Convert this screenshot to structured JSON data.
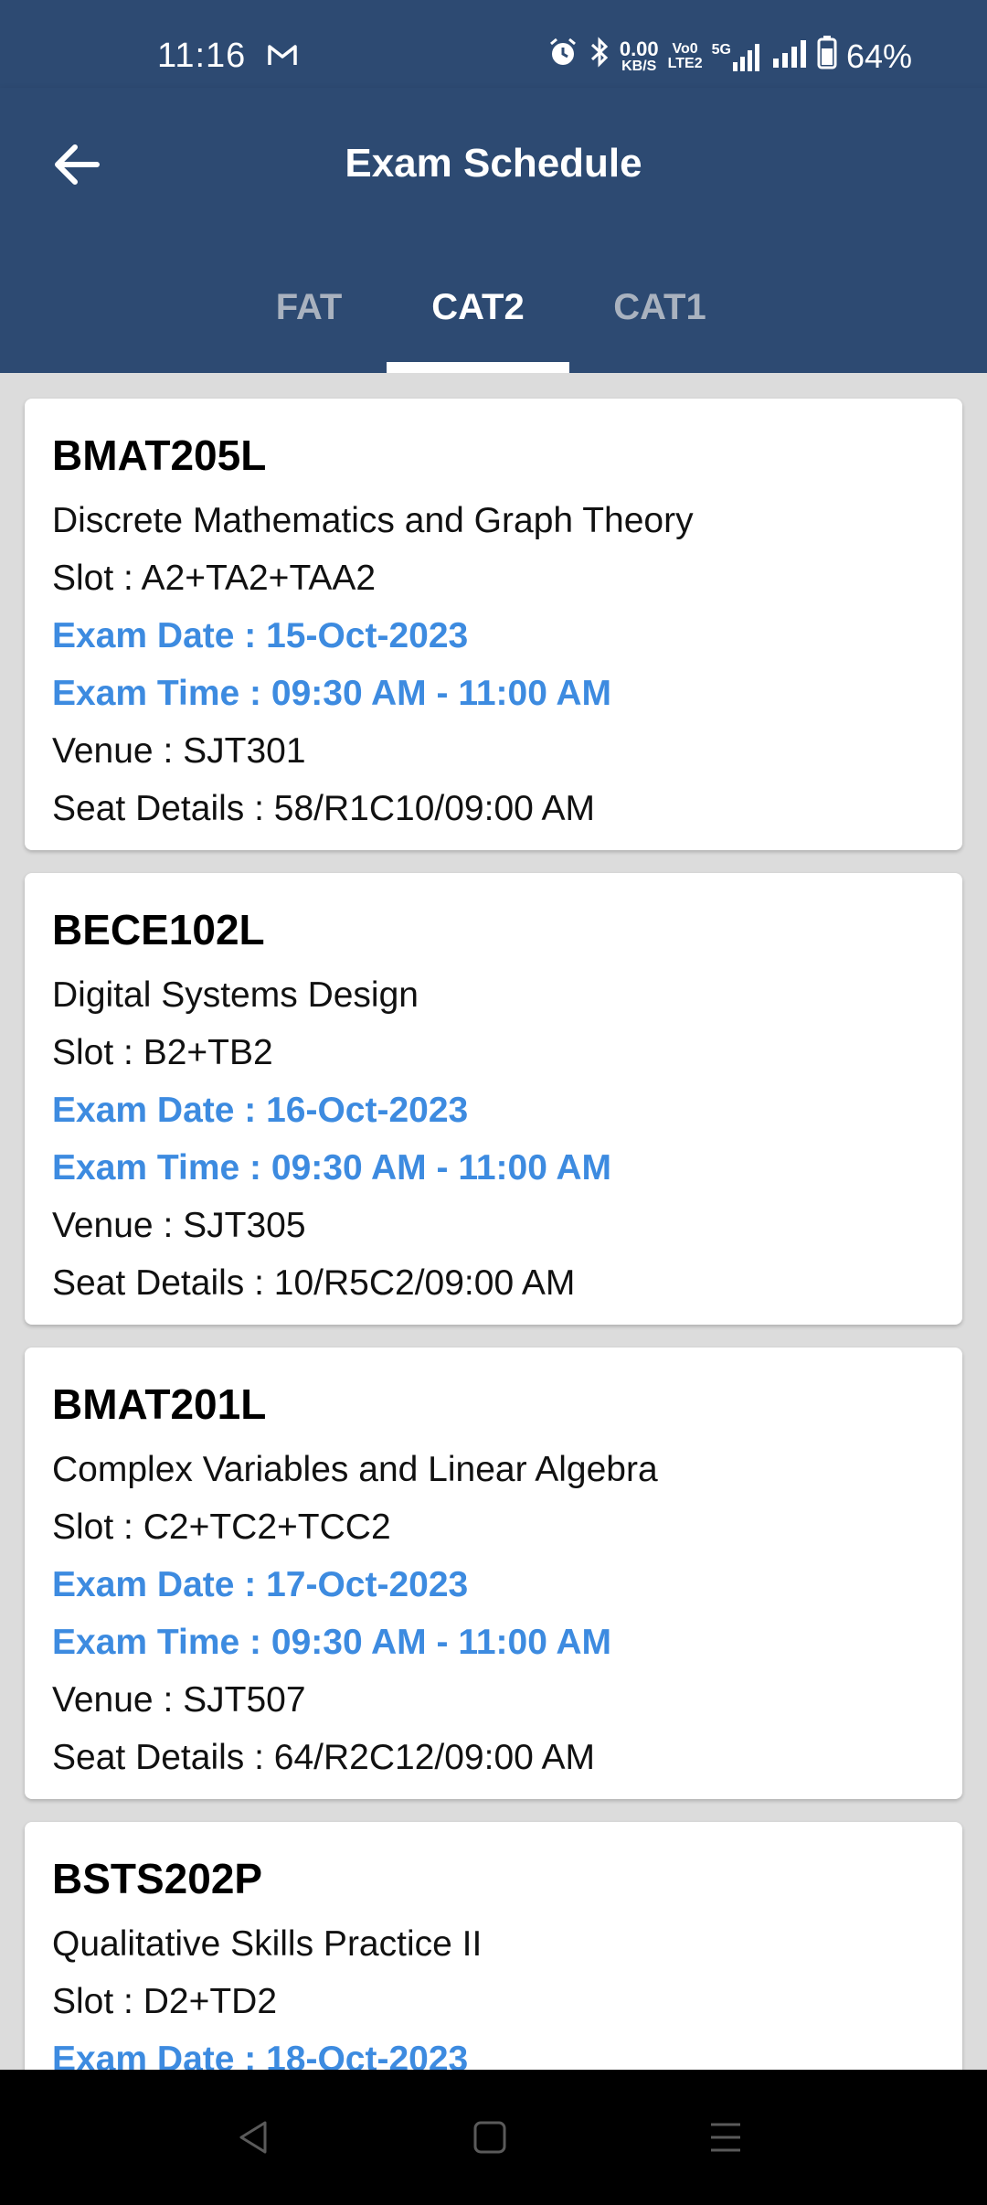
{
  "status_bar": {
    "time": "11:16",
    "net_speed_top": "0.00",
    "net_speed_bottom": "KB/S",
    "volte_top": "Vo0",
    "volte_bottom": "LTE2",
    "network_label": "5G",
    "battery": "64%"
  },
  "header": {
    "title": "Exam Schedule"
  },
  "tabs": [
    {
      "label": "FAT",
      "active": false
    },
    {
      "label": "CAT2",
      "active": true
    },
    {
      "label": "CAT1",
      "active": false
    }
  ],
  "exams": [
    {
      "code": "BMAT205L",
      "title": "Discrete Mathematics and Graph Theory",
      "slot": "Slot : A2+TA2+TAA2",
      "date": "Exam Date : 15-Oct-2023",
      "time": "Exam Time : 09:30 AM - 11:00 AM",
      "venue": "Venue : SJT301",
      "seat": "Seat Details : 58/R1C10/09:00 AM"
    },
    {
      "code": "BECE102L",
      "title": "Digital Systems Design",
      "slot": "Slot : B2+TB2",
      "date": "Exam Date : 16-Oct-2023",
      "time": "Exam Time : 09:30 AM - 11:00 AM",
      "venue": "Venue : SJT305",
      "seat": "Seat Details : 10/R5C2/09:00 AM"
    },
    {
      "code": "BMAT201L",
      "title": "Complex Variables and Linear Algebra",
      "slot": "Slot : C2+TC2+TCC2",
      "date": "Exam Date : 17-Oct-2023",
      "time": "Exam Time : 09:30 AM - 11:00 AM",
      "venue": "Venue : SJT507",
      "seat": "Seat Details : 64/R2C12/09:00 AM"
    },
    {
      "code": "BSTS202P",
      "title": "Qualitative Skills Practice II",
      "slot": "Slot : D2+TD2",
      "date": "Exam Date : 18-Oct-2023"
    }
  ],
  "colors": {
    "primary": "#2d4a72",
    "accent_text": "#3d8be0",
    "background": "#dcdcdc"
  },
  "icons": {
    "back": "arrow-left-icon",
    "nav_back": "triangle-back-icon",
    "nav_home": "square-home-icon",
    "nav_menu": "menu-lines-icon"
  }
}
